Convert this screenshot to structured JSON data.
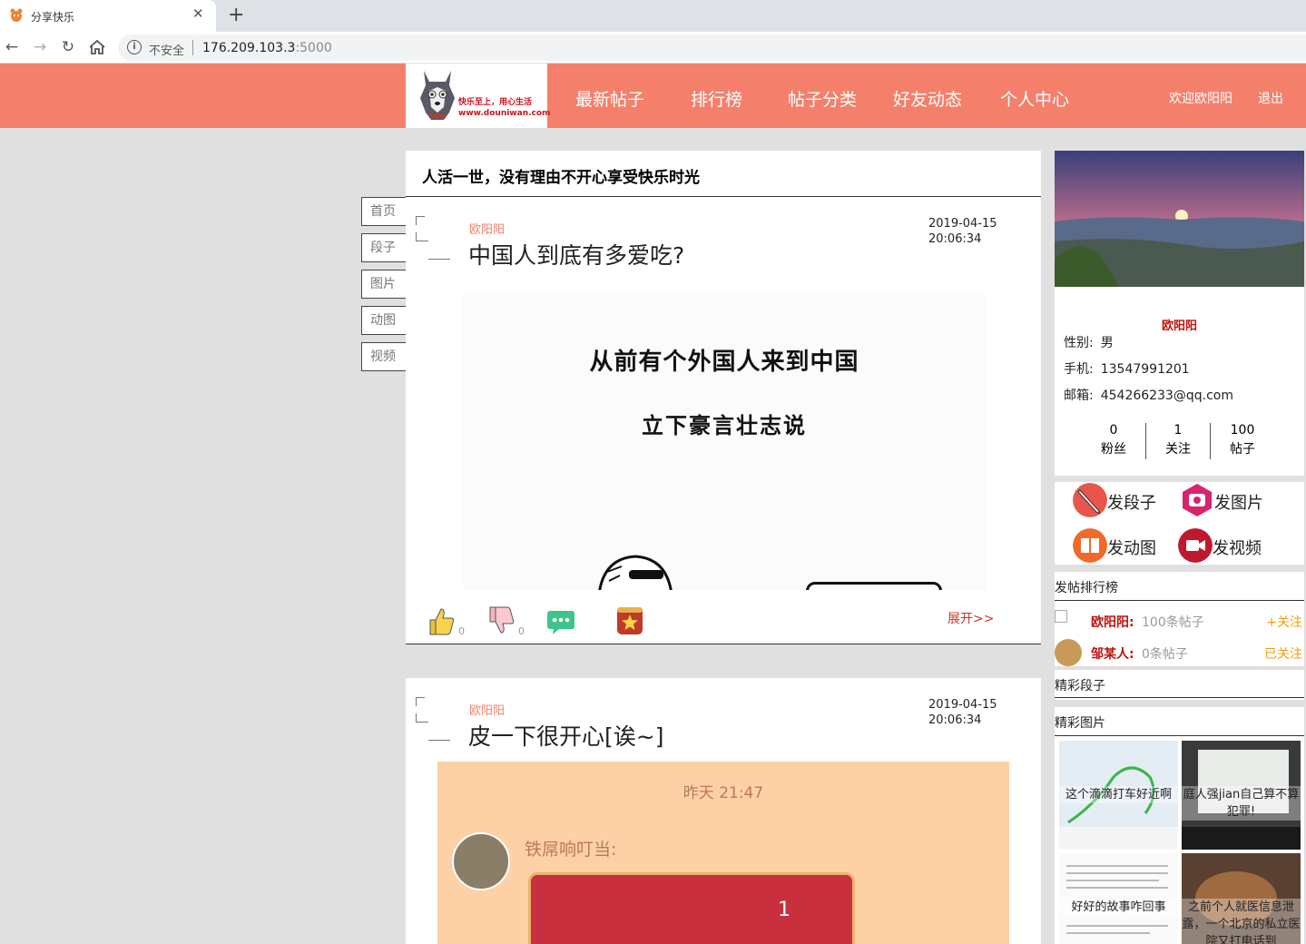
{
  "browser": {
    "tab_title": "分享快乐",
    "security_label": "不安全",
    "url_host": "176.209.103.3",
    "url_port": ":5000"
  },
  "header": {
    "logo_line1": "快乐至上，用心生活",
    "logo_line2": "www.douniwan.com",
    "nav": [
      "最新帖子",
      "排行榜",
      "帖子分类",
      "好友动态",
      "个人中心"
    ],
    "welcome": "欢迎欧阳阳",
    "logout": "退出"
  },
  "categories": [
    "首页",
    "段子",
    "图片",
    "动图",
    "视频"
  ],
  "slogan": "人活一世，没有理由不开心享受快乐时光",
  "posts": [
    {
      "author": "欧阳阳",
      "title": "中国人到底有多爱吃?",
      "date": "2019-04-15",
      "time": "20:06:34",
      "image_text_1": "从前有个外国人来到中国",
      "image_text_2": "立下豪言壮志说",
      "likes": "0",
      "dislikes": "0",
      "expand": "展开>>"
    },
    {
      "author": "欧阳阳",
      "title": "皮一下很开心[诶~]",
      "date": "2019-04-15",
      "time": "20:06:34",
      "image_time": "昨天 21:47",
      "image_name": "铁屌响叮当:",
      "image_num": "1"
    }
  ],
  "profile": {
    "name": "欧阳阳",
    "gender_label": "性别:",
    "gender": "男",
    "phone_label": "手机:",
    "phone": "13547991201",
    "email_label": "邮箱:",
    "email": "454266233@qq.com",
    "stats": [
      {
        "value": "0",
        "label": "粉丝"
      },
      {
        "value": "1",
        "label": "关注"
      },
      {
        "value": "100",
        "label": "帖子"
      }
    ]
  },
  "publish": [
    "发段子",
    "发图片",
    "发动图",
    "发视频"
  ],
  "ranking": {
    "title": "发帖排行榜",
    "rows": [
      {
        "name": "欧阳阳:",
        "count": "100条帖子",
        "action": "+关注"
      },
      {
        "name": "邹某人:",
        "count": "0条帖子",
        "action": "已关注"
      }
    ]
  },
  "jokes_title": "精彩段子",
  "pictures": {
    "title": "精彩图片",
    "items": [
      "这个滴滴打车好近啊",
      "庭人强jian自己算不算犯罪!",
      "好好的故事咋回事",
      "之前个人就医信息泄露，一个北京的私立医院又打电话到"
    ]
  },
  "colors": {
    "header_bg": "#f4806c",
    "accent_red": "#c0120b",
    "follow_orange": "#f39c12"
  }
}
